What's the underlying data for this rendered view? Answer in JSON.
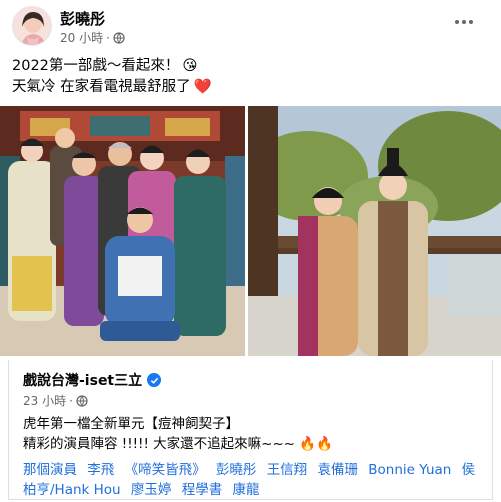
{
  "post": {
    "author": "彭曉彤",
    "time": "20 小時",
    "line1": "2022第一部戲～看起來！",
    "line1_emoji": "😘",
    "line2": "天氣冷 在家看電視最舒服了",
    "line2_emoji": "❤️"
  },
  "shared": {
    "page_name": "戲說台灣-iset三立",
    "time": "23 小時",
    "line1": "虎年第一檔全新單元【痘神飼契子】",
    "line2": "精彩的演員陣容 !!!!! 大家還不追起來嘛~~~",
    "line2_emoji": "🔥🔥",
    "tags": [
      "那個演員",
      "李飛",
      "《啼笑皆飛》",
      "彭曉彤",
      "王信翔",
      "袁備珊",
      "Bonnie Yuan",
      "侯柏亨/Hank Hou",
      "廖玉婷",
      "程學書",
      "康龍"
    ]
  },
  "icons": {
    "globe": "globe-icon",
    "more": "more-options-icon",
    "verified": "verified-badge-icon"
  },
  "colors": {
    "link": "#216fdb",
    "meta": "#65676b",
    "verified": "#1877f2"
  }
}
